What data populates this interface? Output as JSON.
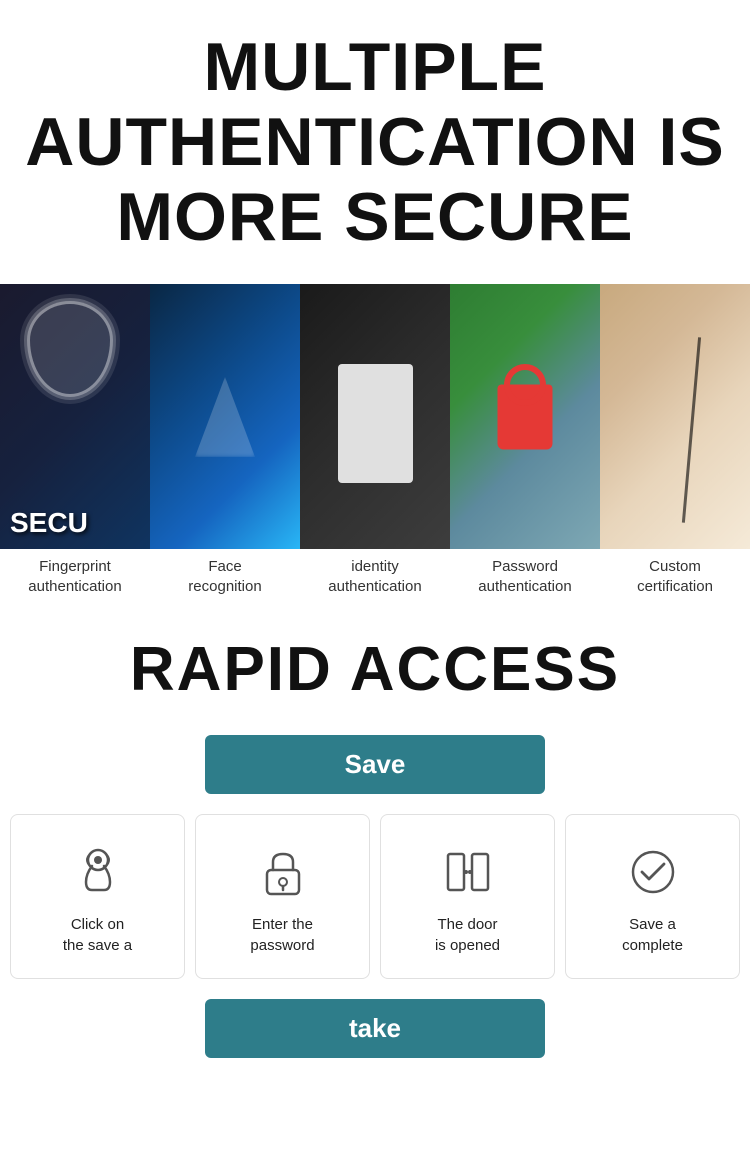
{
  "header": {
    "title_line1": "MULTIPLE",
    "title_line2": "AUTHENTICATION IS",
    "title_line3": "MORE SECURE"
  },
  "gallery": {
    "items": [
      {
        "id": "fingerprint",
        "label_line1": "Fingerprint",
        "label_line2": "authentication",
        "overlay_text": "SECU"
      },
      {
        "id": "face",
        "label_line1": "Face",
        "label_line2": "recognition"
      },
      {
        "id": "identity",
        "label_line1": "identity",
        "label_line2": "authentication"
      },
      {
        "id": "password",
        "label_line1": "Password",
        "label_line2": "authentication"
      },
      {
        "id": "custom",
        "label_line1": "Custom",
        "label_line2": "certification"
      }
    ]
  },
  "rapid": {
    "title": "RAPID ACCESS"
  },
  "buttons": {
    "save_label": "Save",
    "take_label": "take"
  },
  "steps": [
    {
      "icon": "finger-touch",
      "text_line1": "Click on",
      "text_line2": "the save a"
    },
    {
      "icon": "padlock",
      "text_line1": "Enter the",
      "text_line2": "password"
    },
    {
      "icon": "door",
      "text_line1": "The door",
      "text_line2": "is opened"
    },
    {
      "icon": "check-circle",
      "text_line1": "Save a",
      "text_line2": "complete"
    }
  ]
}
